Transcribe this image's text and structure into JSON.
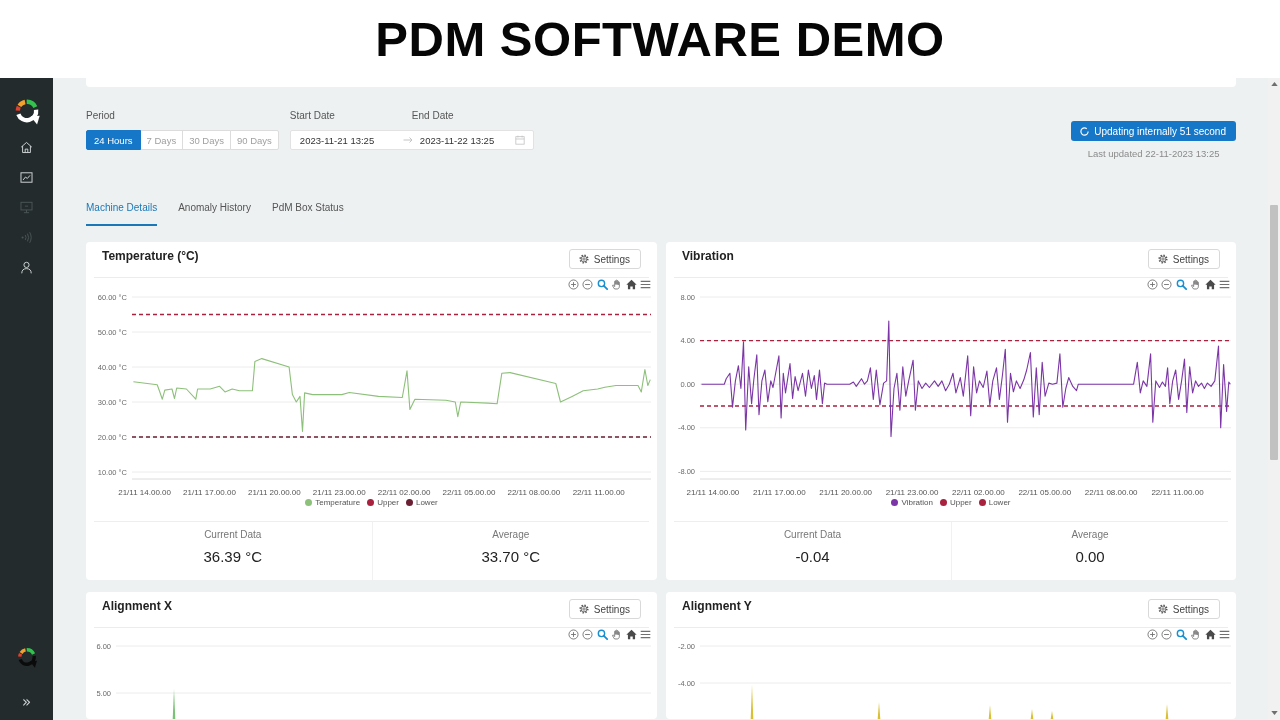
{
  "banner": {
    "title": "PDM SOFTWARE DEMO"
  },
  "sidebar": {
    "items": [
      {
        "kind": "home",
        "disabled": false
      },
      {
        "kind": "chart",
        "disabled": false
      },
      {
        "kind": "monitor",
        "disabled": true
      },
      {
        "kind": "signal",
        "disabled": true
      },
      {
        "kind": "user",
        "disabled": false
      }
    ],
    "expand": "»"
  },
  "filters": {
    "period": {
      "label": "Period",
      "options": [
        {
          "label": "24 Hours",
          "selected": true
        },
        {
          "label": "7 Days",
          "selected": false
        },
        {
          "label": "30 Days",
          "selected": false
        },
        {
          "label": "90 Days",
          "selected": false
        }
      ]
    },
    "start_label": "Start Date",
    "end_label": "End Date",
    "start": "2023-11-21 13:25",
    "end": "2023-11-22 13:25"
  },
  "status": {
    "button": "Updating internally 51 second",
    "last_updated": "Last updated 22-11-2023 13:25"
  },
  "tabs": [
    {
      "label": "Machine Details",
      "selected": true
    },
    {
      "label": "Anomaly History",
      "selected": false
    },
    {
      "label": "PdM Box Status",
      "selected": false
    }
  ],
  "cards": [
    {
      "kind": "line",
      "title": "Temperature (°C)",
      "settings": "Settings",
      "toolbar": [
        {
          "kind": "zoomin",
          "selected": false
        },
        {
          "kind": "zoomout",
          "selected": false
        },
        {
          "kind": "zoom",
          "selected": true
        },
        {
          "kind": "pan",
          "selected": false
        },
        {
          "kind": "home",
          "selected": false
        },
        {
          "kind": "menu",
          "selected": false
        }
      ],
      "chart_data": [
        {
          "type": "line",
          "x": [
            "2023-11-21T13:29",
            "2023-11-21T14:35",
            "2023-11-21T14:41",
            "2023-11-21T14:49",
            "2023-11-21T14:56",
            "2023-11-21T15:16",
            "2023-11-21T15:23",
            "2023-11-21T15:29",
            "2023-11-21T15:56",
            "2023-11-21T16:22",
            "2023-11-21T16:27",
            "2023-11-21T17:02",
            "2023-11-21T17:28",
            "2023-11-21T17:43",
            "2023-11-21T18:03",
            "2023-11-21T18:23",
            "2023-11-21T18:59",
            "2023-11-21T19:06",
            "2023-11-21T19:25",
            "2023-11-21T20:41",
            "2023-11-21T20:50",
            "2023-11-21T21:01",
            "2023-11-21T21:11",
            "2023-11-21T21:18",
            "2023-11-21T21:24",
            "2023-11-21T21:46",
            "2023-11-21T23:07",
            "2023-11-21T23:28",
            "2023-11-22T00:49",
            "2023-11-22T01:55",
            "2023-11-22T02:08",
            "2023-11-22T02:16",
            "2023-11-22T02:30",
            "2023-11-22T03:56",
            "2023-11-22T04:22",
            "2023-11-22T04:29",
            "2023-11-22T04:37",
            "2023-11-22T05:53",
            "2023-11-22T06:18",
            "2023-11-22T06:31",
            "2023-11-22T06:54",
            "2023-11-22T09:01",
            "2023-11-22T09:14",
            "2023-11-22T09:46",
            "2023-11-22T10:17",
            "2023-11-22T10:57",
            "2023-11-22T11:17",
            "2023-11-22T11:48",
            "2023-11-22T12:08",
            "2023-11-22T12:49",
            "2023-11-22T12:58",
            "2023-11-22T13:08",
            "2023-11-22T13:16",
            "2023-11-22T13:23"
          ],
          "series": [
            {
              "name": "Temperature",
              "color": "#8dc07a",
              "values": [
                35.8,
                34.9,
                33.2,
                30.8,
                33.4,
                33.7,
                31.0,
                34.0,
                33.7,
                30.8,
                33.7,
                33.7,
                34.5,
                32.9,
                33.7,
                33.2,
                33.2,
                41.6,
                42.4,
                40.0,
                32.1,
                30.0,
                31.6,
                21.6,
                32.6,
                32.1,
                32.1,
                32.7,
                31.6,
                31.3,
                38.9,
                27.9,
                30.8,
                30.5,
                30.0,
                25.8,
                30.0,
                29.7,
                29.5,
                38.2,
                38.4,
                35.3,
                30.0,
                31.6,
                33.2,
                33.7,
                34.2,
                34.7,
                34.7,
                34.7,
                32.9,
                39.3,
                34.7,
                36.4
              ]
            }
          ],
          "xlim": [
            "2023-11-21T13:25",
            "2023-11-22T13:25"
          ],
          "ylim": [
            8,
            60
          ],
          "xticks": [
            {
              "value": "2023-11-21T14:00",
              "label": "21/11 14.00.00"
            },
            {
              "value": "2023-11-21T17:00",
              "label": "21/11 17.00.00"
            },
            {
              "value": "2023-11-21T20:00",
              "label": "21/11 20.00.00"
            },
            {
              "value": "2023-11-21T23:00",
              "label": "21/11 23.00.00"
            },
            {
              "value": "2023-11-22T02:00",
              "label": "22/11 02.00.00"
            },
            {
              "value": "2023-11-22T05:00",
              "label": "22/11 05.00.00"
            },
            {
              "value": "2023-11-22T08:00",
              "label": "22/11 08.00.00"
            },
            {
              "value": "2023-11-22T11:00",
              "label": "22/11 11.00.00"
            }
          ],
          "yticks": [
            {
              "value": 60,
              "label": "60.00 °C"
            },
            {
              "value": 50,
              "label": "50.00 °C"
            },
            {
              "value": 40,
              "label": "40.00 °C"
            },
            {
              "value": 30,
              "label": "30.00 °C"
            },
            {
              "value": 20,
              "label": "20.00 °C"
            },
            {
              "value": 10,
              "label": "10.00 °C"
            }
          ],
          "ref_lines": [
            {
              "axis": "y",
              "value": 55,
              "label": "Upper",
              "color": "#a8213e",
              "line_style": "dashed"
            },
            {
              "axis": "y",
              "value": 20,
              "label": "Lower",
              "color": "#6a1f33",
              "line_style": "dashed"
            }
          ],
          "grid": true,
          "legend": "bottom"
        }
      ],
      "stats": [
        {
          "label": "Current Data",
          "value": "36.39 °C"
        },
        {
          "label": "Average",
          "value": "33.70 °C"
        }
      ]
    },
    {
      "kind": "line",
      "title": "Vibration",
      "settings": "Settings",
      "toolbar": [
        {
          "kind": "zoomin",
          "selected": false
        },
        {
          "kind": "zoomout",
          "selected": false
        },
        {
          "kind": "zoom",
          "selected": true
        },
        {
          "kind": "pan",
          "selected": false
        },
        {
          "kind": "home",
          "selected": false
        },
        {
          "kind": "menu",
          "selected": false
        }
      ],
      "chart_data": [
        {
          "type": "line",
          "x": [
            "2023-11-21T13:29",
            "2023-11-21T14:31",
            "2023-11-21T14:36",
            "2023-11-21T14:46",
            "2023-11-21T14:53",
            "2023-11-21T15:01",
            "2023-11-21T15:09",
            "2023-11-21T15:16",
            "2023-11-21T15:23",
            "2023-11-21T15:29",
            "2023-11-21T15:37",
            "2023-11-21T15:45",
            "2023-11-21T15:51",
            "2023-11-21T15:59",
            "2023-11-21T16:05",
            "2023-11-21T16:13",
            "2023-11-21T16:21",
            "2023-11-21T16:29",
            "2023-11-21T16:37",
            "2023-11-21T16:43",
            "2023-11-21T16:59",
            "2023-11-21T17:05",
            "2023-11-21T17:11",
            "2023-11-21T17:17",
            "2023-11-21T17:29",
            "2023-11-21T17:36",
            "2023-11-21T17:43",
            "2023-11-21T17:51",
            "2023-11-21T18:03",
            "2023-11-21T18:11",
            "2023-11-21T18:19",
            "2023-11-21T18:27",
            "2023-11-21T18:35",
            "2023-11-21T18:41",
            "2023-11-21T18:49",
            "2023-11-21T18:57",
            "2023-11-21T19:03",
            "2023-11-21T19:09",
            "2023-11-21T20:11",
            "2023-11-21T20:21",
            "2023-11-21T20:29",
            "2023-11-21T20:43",
            "2023-11-21T20:51",
            "2023-11-21T20:59",
            "2023-11-21T21:07",
            "2023-11-21T21:15",
            "2023-11-21T21:23",
            "2023-11-21T21:33",
            "2023-11-21T21:43",
            "2023-11-21T21:51",
            "2023-11-21T21:57",
            "2023-11-21T22:03",
            "2023-11-21T22:11",
            "2023-11-21T22:19",
            "2023-11-21T22:27",
            "2023-11-21T22:35",
            "2023-11-21T22:43",
            "2023-11-21T22:51",
            "2023-11-21T23:03",
            "2023-11-21T23:09",
            "2023-11-21T23:17",
            "2023-11-21T23:27",
            "2023-11-21T23:37",
            "2023-11-21T23:47",
            "2023-11-22T00:01",
            "2023-11-22T00:11",
            "2023-11-22T00:21",
            "2023-11-22T00:31",
            "2023-11-22T00:41",
            "2023-11-22T00:51",
            "2023-11-22T00:59",
            "2023-11-22T01:11",
            "2023-11-22T01:19",
            "2023-11-22T01:31",
            "2023-11-22T01:39",
            "2023-11-22T01:47",
            "2023-11-22T01:55",
            "2023-11-22T02:03",
            "2023-11-22T02:13",
            "2023-11-22T02:23",
            "2023-11-22T02:31",
            "2023-11-22T02:39",
            "2023-11-22T02:49",
            "2023-11-22T02:57",
            "2023-11-22T03:05",
            "2023-11-22T03:13",
            "2023-11-22T03:19",
            "2023-11-22T03:27",
            "2023-11-22T03:35",
            "2023-11-22T03:43",
            "2023-11-22T03:53",
            "2023-11-22T04:03",
            "2023-11-22T04:11",
            "2023-11-22T04:21",
            "2023-11-22T04:29",
            "2023-11-22T04:37",
            "2023-11-22T04:45",
            "2023-11-22T04:53",
            "2023-11-22T05:01",
            "2023-11-22T05:11",
            "2023-11-22T05:21",
            "2023-11-22T05:33",
            "2023-11-22T05:41",
            "2023-11-22T05:49",
            "2023-11-22T05:57",
            "2023-11-22T06:05",
            "2023-11-22T06:16",
            "2023-11-22T06:26",
            "2023-11-22T06:31",
            "2023-11-22T09:01",
            "2023-11-22T09:11",
            "2023-11-22T09:19",
            "2023-11-22T09:27",
            "2023-11-22T09:37",
            "2023-11-22T09:47",
            "2023-11-22T09:53",
            "2023-11-22T10:01",
            "2023-11-22T10:11",
            "2023-11-22T10:19",
            "2023-11-22T10:27",
            "2023-11-22T10:33",
            "2023-11-22T10:39",
            "2023-11-22T10:47",
            "2023-11-22T10:55",
            "2023-11-22T11:03",
            "2023-11-22T11:11",
            "2023-11-22T11:19",
            "2023-11-22T11:25",
            "2023-11-22T11:33",
            "2023-11-22T11:41",
            "2023-11-22T11:49",
            "2023-11-22T11:57",
            "2023-11-22T12:05",
            "2023-11-22T12:13",
            "2023-11-22T12:21",
            "2023-11-22T12:31",
            "2023-11-22T12:41",
            "2023-11-22T12:51",
            "2023-11-22T12:57",
            "2023-11-22T13:05",
            "2023-11-22T13:13",
            "2023-11-22T13:19",
            "2023-11-22T13:23"
          ],
          "series": [
            {
              "name": "Vibration",
              "color": "#7b35a6",
              "values": [
                0,
                0,
                0.5,
                1.0,
                -2.1,
                0.3,
                1.7,
                -0.4,
                3.9,
                -4.2,
                1.6,
                -1.8,
                0.4,
                2.7,
                -2.8,
                0.3,
                1.3,
                -1.6,
                0.3,
                -0.3,
                2.6,
                -3.1,
                1.0,
                -0.8,
                1.9,
                -1.3,
                0.7,
                -0.6,
                1.0,
                -1.1,
                1.3,
                -0.4,
                0.8,
                -1.4,
                1.3,
                -1.8,
                0.1,
                0,
                0,
                0.2,
                -0.2,
                0.5,
                0,
                0.3,
                1.5,
                -1.4,
                1.3,
                -1.9,
                0.1,
                0.3,
                5.8,
                -4.8,
                -0.4,
                1.0,
                -2.4,
                1.6,
                -1.1,
                0.3,
                2.2,
                -2.4,
                0.3,
                -0.4,
                0.1,
                -0.3,
                0.3,
                -0.2,
                0.3,
                -0.6,
                0,
                1.0,
                -0.8,
                0.6,
                -1.1,
                2.6,
                -2.9,
                1.6,
                -0.8,
                0.3,
                -0.3,
                1.2,
                -1.9,
                0.3,
                1.5,
                -1.4,
                0.8,
                3.2,
                -3.5,
                1.0,
                -0.7,
                0.3,
                -0.4,
                0.4,
                1.3,
                2.9,
                -3.0,
                1.5,
                -2.8,
                2.0,
                -1.1,
                0.1,
                0,
                0.1,
                2.8,
                -2.1,
                -0.4,
                0.6,
                -0.2,
                -0.6,
                0,
                0,
                2.0,
                -0.8,
                0.3,
                -0.2,
                2.8,
                -3.5,
                0.3,
                -0.3,
                0.2,
                -0.2,
                1.5,
                -1.8,
                0.3,
                1.3,
                -1.4,
                0.3,
                2.3,
                -2.6,
                1.6,
                -0.8,
                0.3,
                -0.2,
                0.1,
                -0.4,
                0.1,
                -0.2,
                0.3,
                3.5,
                -4.0,
                1.8,
                -2.5,
                0.2,
                0
              ]
            }
          ],
          "xlim": [
            "2023-11-21T13:25",
            "2023-11-22T13:25"
          ],
          "ylim": [
            -8.7,
            8
          ],
          "xticks": [
            {
              "value": "2023-11-21T14:00",
              "label": "21/11 14.00.00"
            },
            {
              "value": "2023-11-21T17:00",
              "label": "21/11 17.00.00"
            },
            {
              "value": "2023-11-21T20:00",
              "label": "21/11 20.00.00"
            },
            {
              "value": "2023-11-21T23:00",
              "label": "21/11 23.00.00"
            },
            {
              "value": "2023-11-22T02:00",
              "label": "22/11 02.00.00"
            },
            {
              "value": "2023-11-22T05:00",
              "label": "22/11 05.00.00"
            },
            {
              "value": "2023-11-22T08:00",
              "label": "22/11 08.00.00"
            },
            {
              "value": "2023-11-22T11:00",
              "label": "22/11 11.00.00"
            }
          ],
          "yticks": [
            {
              "value": 8,
              "label": "8.00"
            },
            {
              "value": 4,
              "label": "4.00"
            },
            {
              "value": 0,
              "label": "0.00"
            },
            {
              "value": -4,
              "label": "-4.00"
            },
            {
              "value": -8,
              "label": "-8.00"
            }
          ],
          "ref_lines": [
            {
              "axis": "y",
              "value": 4,
              "label": "Upper",
              "color": "#a8213e",
              "line_style": "dashed"
            },
            {
              "axis": "y",
              "value": -2,
              "label": "Lower",
              "color": "#a8213e",
              "line_style": "dashed"
            }
          ],
          "grid": true,
          "legend": "bottom"
        }
      ],
      "stats": [
        {
          "label": "Current Data",
          "value": "-0.04"
        },
        {
          "label": "Average",
          "value": "0.00"
        }
      ]
    },
    {
      "kind": "preview",
      "title": "Alignment X",
      "settings": "Settings",
      "toolbar": [
        {
          "kind": "zoomin",
          "selected": false
        },
        {
          "kind": "zoomout",
          "selected": false
        },
        {
          "kind": "zoom",
          "selected": true
        },
        {
          "kind": "pan",
          "selected": false
        },
        {
          "kind": "home",
          "selected": false
        },
        {
          "kind": "menu",
          "selected": false
        }
      ],
      "y_tick_labels": [
        "6.00",
        "5.00"
      ]
    },
    {
      "kind": "preview",
      "title": "Alignment Y",
      "settings": "Settings",
      "toolbar": [
        {
          "kind": "zoomin",
          "selected": false
        },
        {
          "kind": "zoomout",
          "selected": false
        },
        {
          "kind": "zoom",
          "selected": true
        },
        {
          "kind": "pan",
          "selected": false
        },
        {
          "kind": "home",
          "selected": false
        },
        {
          "kind": "menu",
          "selected": false
        }
      ],
      "y_tick_labels": [
        "-2.00",
        "-4.00"
      ]
    }
  ]
}
